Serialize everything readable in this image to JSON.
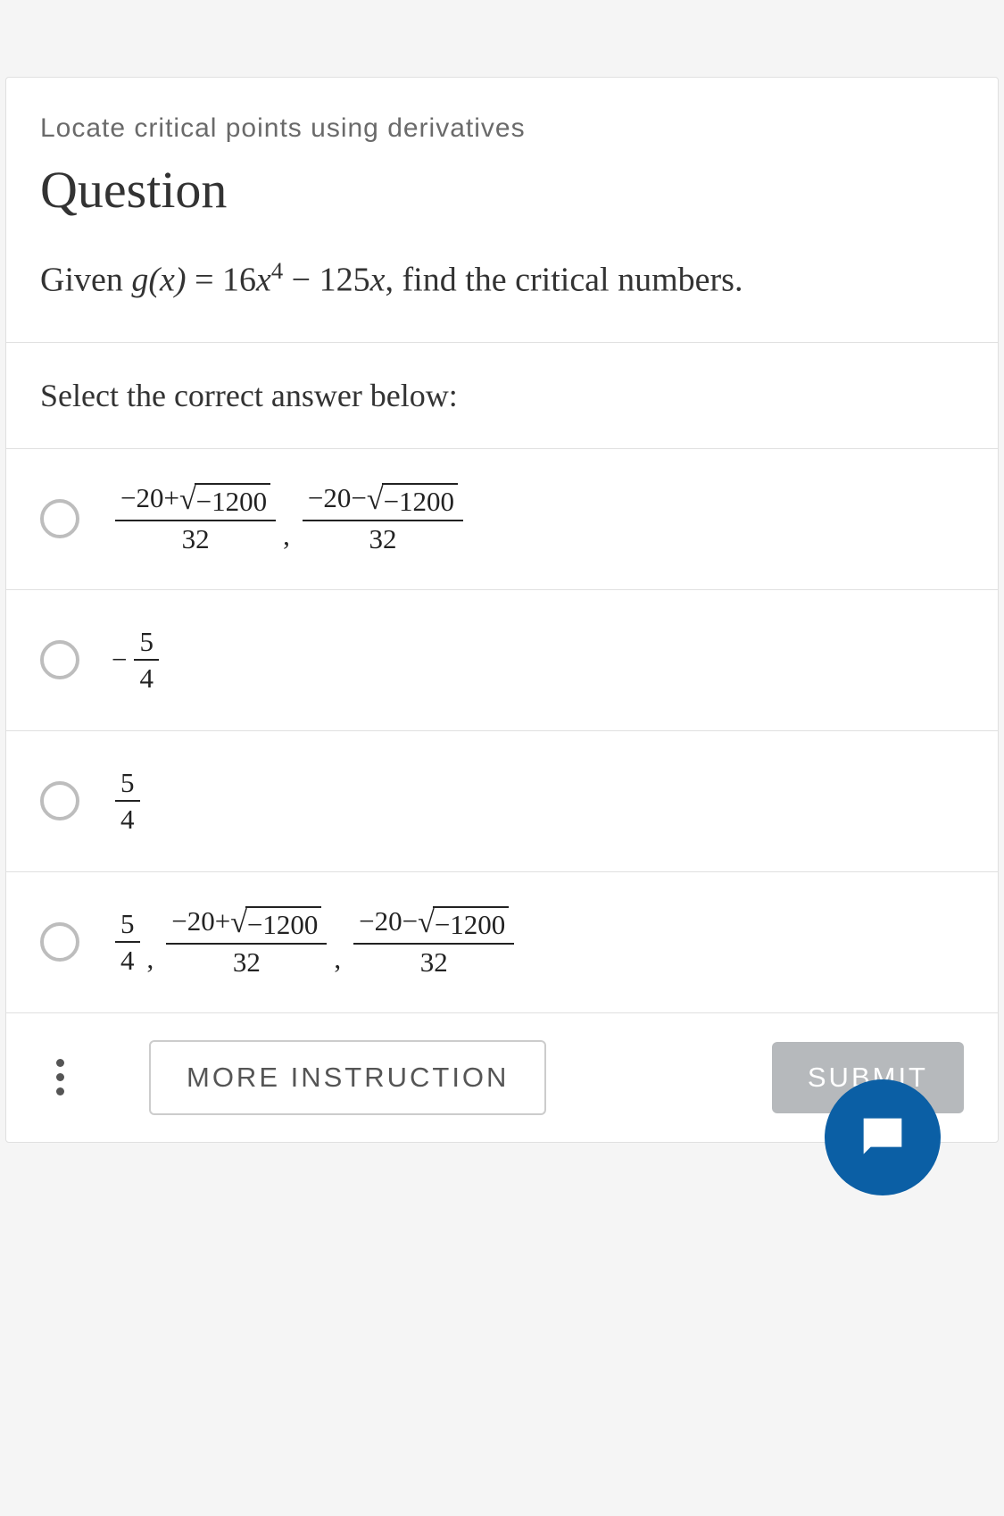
{
  "header": {
    "topic": "Locate critical points using derivatives",
    "title": "Question"
  },
  "prompt": {
    "pre": "Given ",
    "func": "g(x)",
    "eq": " = 16",
    "var": "x",
    "exp": "4",
    "mid": " − 125",
    "var2": "x",
    "post": ", find the critical numbers."
  },
  "instruction": "Select the correct answer below:",
  "options": {
    "a": {
      "term1_num_left": "−20+",
      "sqrt_arg1": "−1200",
      "term1_den": "32",
      "term2_num_left": "−20−",
      "sqrt_arg2": "−1200",
      "term2_den": "32"
    },
    "b": {
      "minus": "−",
      "num": "5",
      "den": "4"
    },
    "c": {
      "num": "5",
      "den": "4"
    },
    "d": {
      "f1_num": "5",
      "f1_den": "4",
      "term1_num_left": "−20+",
      "sqrt_arg1": "−1200",
      "term1_den": "32",
      "term2_num_left": "−20−",
      "sqrt_arg2": "−1200",
      "term2_den": "32"
    }
  },
  "footer": {
    "more": "MORE INSTRUCTION",
    "submit": "SUBMIT"
  }
}
